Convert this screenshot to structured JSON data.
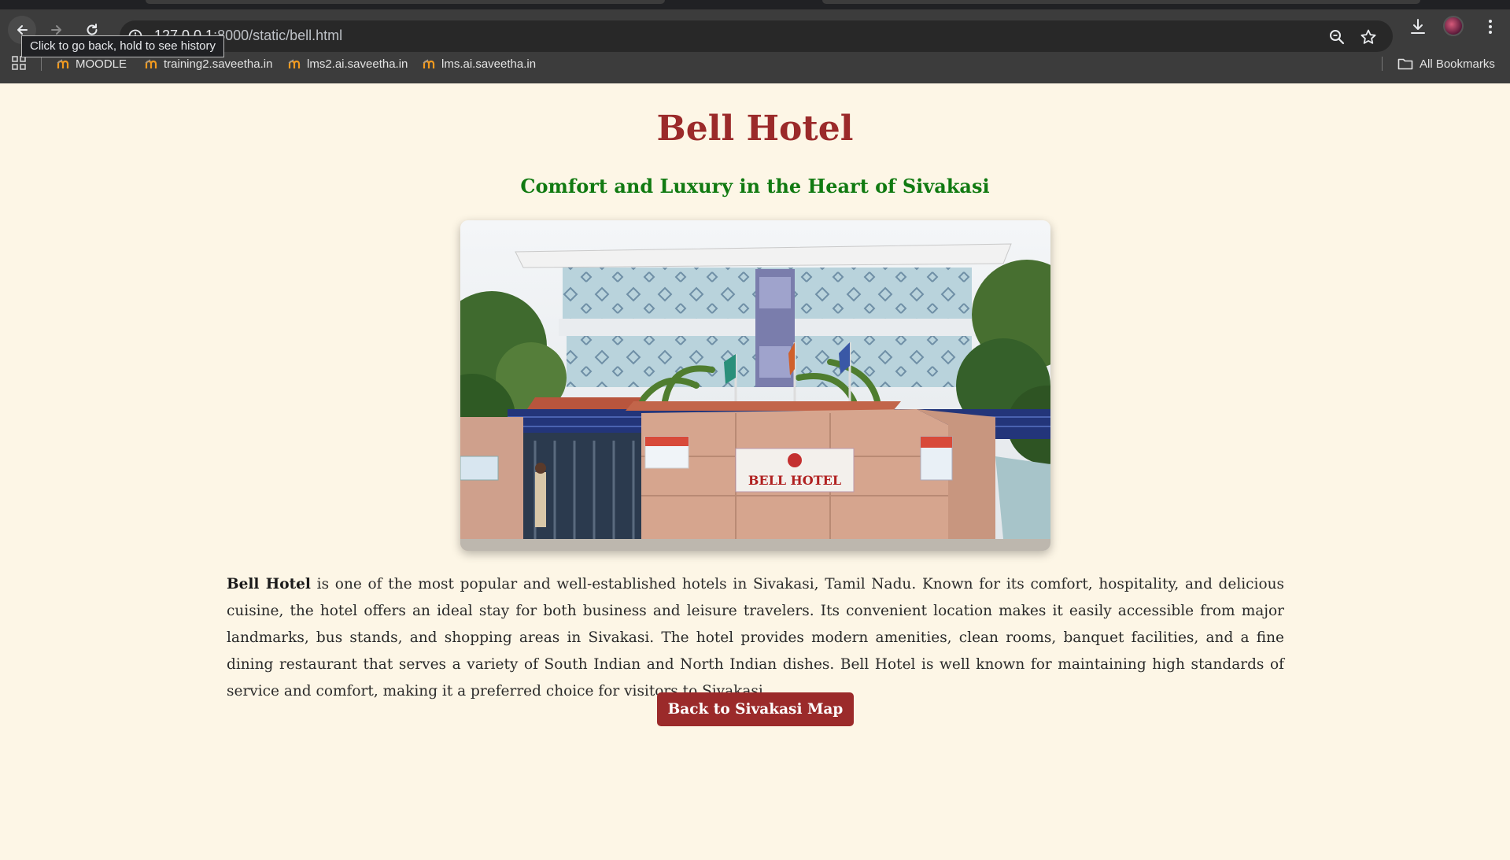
{
  "browser": {
    "url_host": "127.0.0.1",
    "url_rest": ":8000/static/bell.html",
    "tooltip": "Click to go back, hold to see history",
    "bookmarks": [
      {
        "label": "MOODLE",
        "icon": "moodle-icon"
      },
      {
        "label": "training2.saveetha.in",
        "icon": "moodle-icon"
      },
      {
        "label": "lms2.ai.saveetha.in",
        "icon": "moodle-icon"
      },
      {
        "label": "lms.ai.saveetha.in",
        "icon": "moodle-icon"
      }
    ],
    "all_bookmarks": "All Bookmarks"
  },
  "page": {
    "title": "Bell Hotel",
    "subtitle": "Comfort and Luxury in the Heart of Sivakasi",
    "hero_sign": "BELL HOTEL",
    "description_bold": "Bell Hotel",
    "description_rest": " is one of the most popular and well-established hotels in Sivakasi, Tamil Nadu. Known for its comfort, hospitality, and delicious cuisine, the hotel offers an ideal stay for both business and leisure travelers. Its convenient location makes it easily accessible from major landmarks, bus stands, and shopping areas in Sivakasi. The hotel provides modern amenities, clean rooms, banquet facilities, and a fine dining restaurant that serves a variety of South Indian and North Indian dishes. Bell Hotel is well known for maintaining high standards of service and comfort, making it a preferred choice for visitors to Sivakasi.",
    "back_button": "Back to Sivakasi Map"
  },
  "colors": {
    "title": "#9b2a2a",
    "subtitle": "#117a11",
    "button": "#9b2a2a",
    "background": "#fdf6e6"
  }
}
